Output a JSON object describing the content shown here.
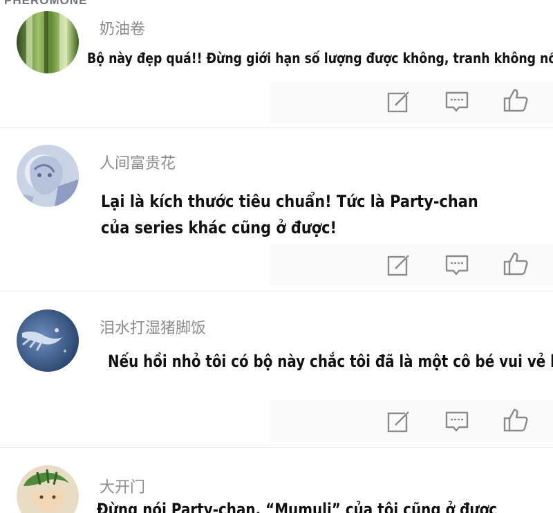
{
  "watermark": "PHEROMONE",
  "comments": [
    {
      "username": "奶油卷",
      "lines": [
        "Bộ này đẹp quá!! Đừng giới hạn số lượng được không, tranh không nổi đâu!"
      ],
      "avatar": "bamboo-avatar"
    },
    {
      "username": "人间富贵花",
      "lines": [
        "Lại là kích thước tiêu chuẩn! Tức là Party-chan",
        "của series khác cũng ở được!"
      ],
      "avatar": "statue-avatar"
    },
    {
      "username": "泪水打湿猪脚饭",
      "lines": [
        "Nếu hồi nhỏ tôi có bộ này chắc tôi đã là một cô bé vui vẻ lắm."
      ],
      "avatar": "hand-avatar"
    },
    {
      "username": "大开门",
      "lines": [
        "Đừng nói Party-chan, “Mumuli” của tôi cũng ở được"
      ],
      "avatar": "illustration-avatar"
    }
  ],
  "icons": {
    "edit": "edit-icon",
    "reply": "comment-icon",
    "like": "thumbs-up-icon"
  },
  "colors": {
    "username": "#8c8c8c",
    "text": "#111111",
    "icon": "#8a8a8a"
  }
}
